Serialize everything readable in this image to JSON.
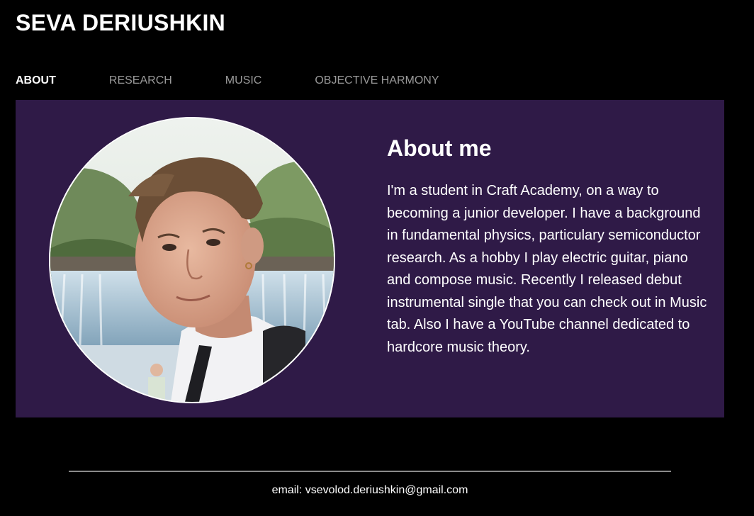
{
  "header": {
    "site_title": "SEVA DERIUSHKIN"
  },
  "nav": {
    "items": [
      {
        "label": "ABOUT",
        "active": true
      },
      {
        "label": "RESEARCH",
        "active": false
      },
      {
        "label": "MUSIC",
        "active": false
      },
      {
        "label": "OBJECTIVE HARMONY",
        "active": false
      }
    ]
  },
  "about": {
    "title": "About me",
    "text": "I'm a student in Craft Academy, on a way to becoming a junior developer. I have a background in fundamental physics, particulary semiconductor research. As a hobby I play electric guitar, piano and compose music. Recently I released debut instrumental single that you can check out in Music tab. Also I have a YouTube channel dedicated to hardcore music theory."
  },
  "footer": {
    "email_text": "email: vsevolod.deriushkin@gmail.com"
  },
  "colors": {
    "page_background": "#000000",
    "content_background": "#2f1a47",
    "nav_active": "#ffffff",
    "nav_inactive": "#9a9a9a",
    "divider": "#8a8a8a"
  }
}
